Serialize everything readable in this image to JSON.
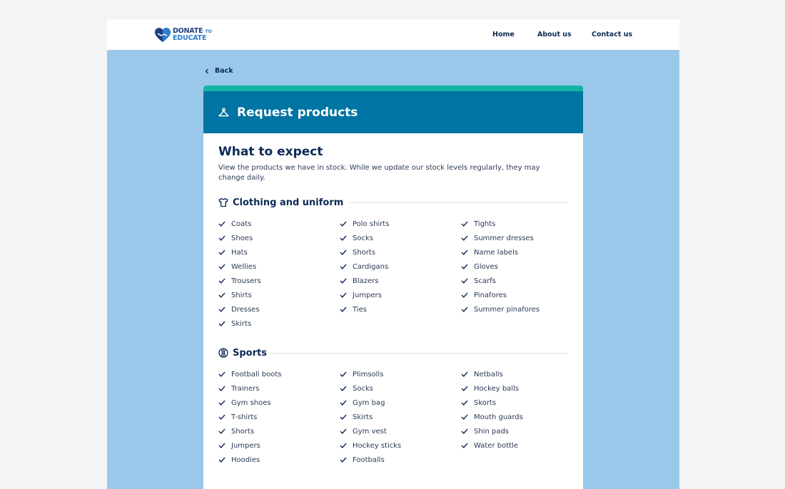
{
  "header": {
    "logo": {
      "line1": "DONATE",
      "line1_small": "TO",
      "line2": "EDUCATE"
    },
    "nav": [
      "Home",
      "About us",
      "Contact us"
    ]
  },
  "back_label": "Back",
  "card": {
    "title": "Request products",
    "heading": "What to expect",
    "intro": "View the products we have in stock. While we update our stock levels regularly, they may change daily.",
    "sections": [
      {
        "title": "Clothing and uniform",
        "icon": "tshirt-icon",
        "columns": [
          [
            "Coats",
            "Shoes",
            "Hats",
            "Wellies",
            "Trousers",
            "Shirts",
            "Dresses",
            "Skirts"
          ],
          [
            "Polo shirts",
            "Socks",
            "Shorts",
            "Cardigans",
            "Blazers",
            "Jumpers",
            "Ties"
          ],
          [
            "Tights",
            "Summer dresses",
            "Name labels",
            "Gloves",
            "Scarfs",
            "Pinafores",
            "Summer pinafores"
          ]
        ]
      },
      {
        "title": "Sports",
        "icon": "ball-icon",
        "columns": [
          [
            "Football boots",
            "Trainers",
            "Gym shoes",
            "T-shirts",
            "Shorts",
            "Jumpers",
            "Hoodies"
          ],
          [
            "Plimsolls",
            "Socks",
            "Gym bag",
            "Skirts",
            "Gym vest",
            "Hockey sticks",
            "Footballs"
          ],
          [
            "Netballs",
            "Hockey balls",
            "Skorts",
            "Mouth guards",
            "Shin pads",
            "Water bottle"
          ]
        ]
      }
    ]
  },
  "colors": {
    "page_bg": "#f2f4f6",
    "frame_bg": "#9ac8eb",
    "card_header": "#0074a3",
    "card_accent": "#14b3a3",
    "text_dark": "#0b2a55"
  }
}
